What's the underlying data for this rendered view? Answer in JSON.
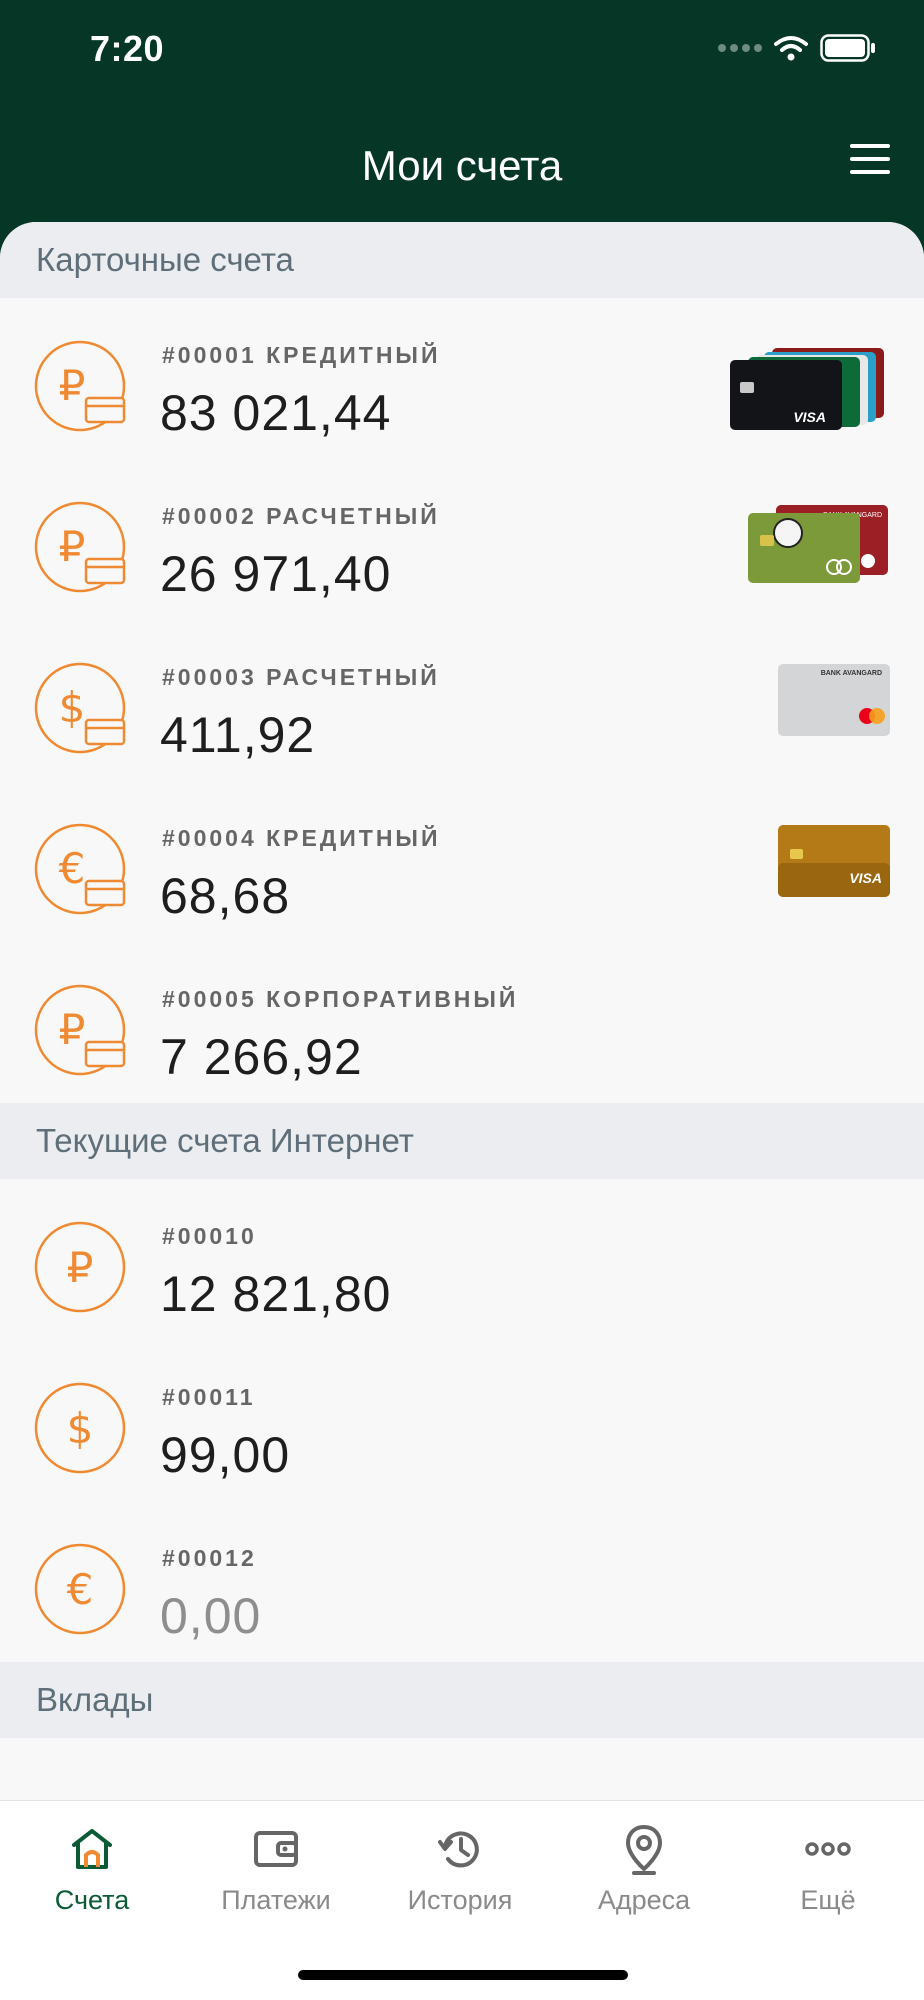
{
  "status": {
    "time": "7:20"
  },
  "header": {
    "title": "Мои счета"
  },
  "card_accounts": {
    "section_title": "Карточные счета",
    "items": [
      {
        "number": "#00001 КРЕДИТНЫЙ",
        "amount": "83 021,44",
        "currency_icon": "ruble-icon",
        "card_brand": "VISA"
      },
      {
        "number": "#00002 РАСЧЕТНЫЙ",
        "amount": "26 971,40",
        "currency_icon": "ruble-icon",
        "card_brand": "BANK AVANGARD"
      },
      {
        "number": "#00003 РАСЧЕТНЫЙ",
        "amount": "411,92",
        "currency_icon": "dollar-icon",
        "card_brand": "BANK AVANGARD"
      },
      {
        "number": "#00004 КРЕДИТНЫЙ",
        "amount": "68,68",
        "currency_icon": "euro-icon",
        "card_brand": "VISA"
      },
      {
        "number": "#00005 КОРПОРАТИВНЫЙ",
        "amount": "7 266,92",
        "currency_icon": "ruble-icon"
      }
    ]
  },
  "internet_accounts": {
    "section_title": "Текущие счета Интернет",
    "items": [
      {
        "number": "#00010",
        "amount": "12 821,80",
        "currency_icon": "ruble-icon"
      },
      {
        "number": "#00011",
        "amount": "99,00",
        "currency_icon": "dollar-icon"
      },
      {
        "number": "#00012",
        "amount": "0,00",
        "currency_icon": "euro-icon"
      }
    ]
  },
  "deposits": {
    "section_title": "Вклады"
  },
  "tabbar": {
    "accounts": "Счета",
    "payments": "Платежи",
    "history": "История",
    "addresses": "Адреса",
    "more": "Ещё"
  },
  "colors": {
    "brand_green": "#063726",
    "accent_orange": "#f08a32",
    "active_tab": "#0c5b37"
  }
}
